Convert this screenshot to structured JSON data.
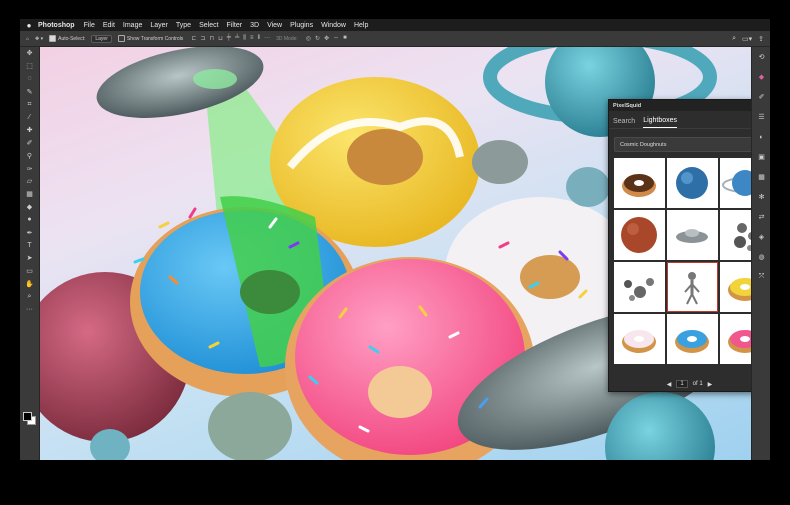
{
  "menubar": {
    "apple": "",
    "app_name": "Photoshop",
    "items": [
      "File",
      "Edit",
      "Image",
      "Layer",
      "Type",
      "Select",
      "Filter",
      "3D",
      "View",
      "Plugins",
      "Window",
      "Help"
    ]
  },
  "options_bar": {
    "auto_select_label": "Auto-Select:",
    "auto_select_value": "Layer",
    "transform_label": "Show Transform Controls",
    "mode_label": "3D Mode:"
  },
  "panel": {
    "title": "PixelSquid",
    "tabs": [
      "Search",
      "Lightboxes"
    ],
    "active_tab": "Lightboxes",
    "dropdown_value": "Cosmic Doughnuts",
    "thumbnails": [
      "chocolate doughnut",
      "blue planet",
      "planet with rings",
      "red planet",
      "flying saucer",
      "asteroid rocks",
      "asteroids",
      "alien figure",
      "yellow doughnut",
      "pink frosted doughnut",
      "blue frosted doughnut",
      "pink doughnut"
    ],
    "selected_thumbnail": 7,
    "page_current": "1",
    "page_total_label": "of 1"
  },
  "colors": {
    "accent": "#e05fa0",
    "selection": "#c13a2e",
    "ui_bg": "#3a3a3a"
  }
}
